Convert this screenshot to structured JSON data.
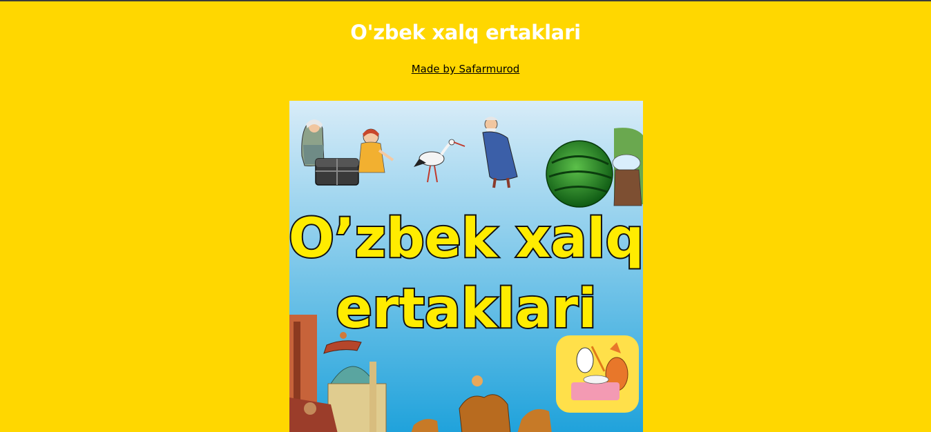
{
  "page": {
    "title": "O'zbek xalq ertaklari",
    "credit_link": "Made by Safarmurod",
    "background_color": "#FFD700"
  },
  "cover": {
    "title_line1": "O’zbek xalq",
    "title_line2": "ertaklari",
    "title_fill_color": "#FFEC00",
    "title_stroke_color": "#111111",
    "sky_top_color": "#D8ECF8",
    "sky_bottom_color": "#1FA2DB",
    "illustrations": [
      "old-woman-icon",
      "chest-icon",
      "girl-icon",
      "stork-icon",
      "old-man-icon",
      "watermelon-icon",
      "man-turban-icon",
      "flying-carpet-icon",
      "palace-icon",
      "caravan-camels-icon",
      "stork-and-fox-icon"
    ]
  }
}
